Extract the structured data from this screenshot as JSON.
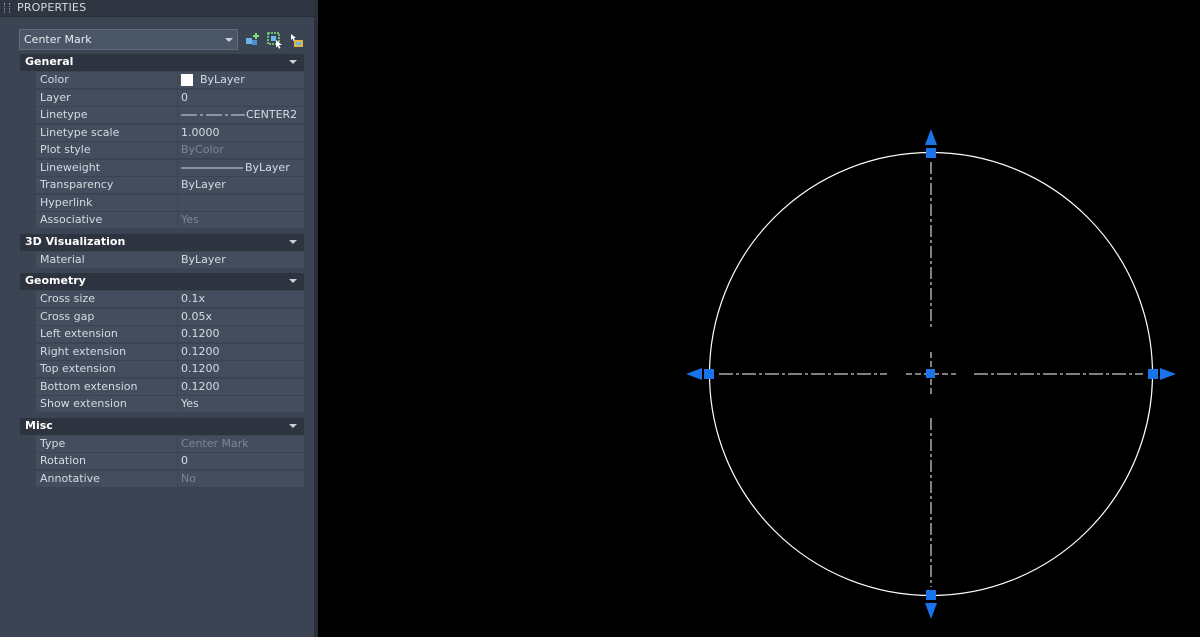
{
  "panel": {
    "title": "PROPERTIES",
    "selector": {
      "value": "Center Mark"
    },
    "toolbar": {
      "icons": [
        "toggle-pickadd-icon",
        "select-objects-icon",
        "quick-select-icon"
      ]
    }
  },
  "sections": [
    {
      "title": "General",
      "rows": [
        {
          "name": "Color",
          "value": "ByLayer",
          "swatch": "#ffffff"
        },
        {
          "name": "Layer",
          "value": "0"
        },
        {
          "name": "Linetype",
          "value": "CENTER2",
          "linetype": true
        },
        {
          "name": "Linetype scale",
          "value": "1.0000"
        },
        {
          "name": "Plot style",
          "value": "ByColor",
          "dim": true
        },
        {
          "name": "Lineweight",
          "value": "ByLayer",
          "lineweight": true
        },
        {
          "name": "Transparency",
          "value": "ByLayer"
        },
        {
          "name": "Hyperlink",
          "value": ""
        },
        {
          "name": "Associative",
          "value": "Yes",
          "dim": true
        }
      ]
    },
    {
      "title": "3D Visualization",
      "rows": [
        {
          "name": "Material",
          "value": "ByLayer"
        }
      ]
    },
    {
      "title": "Geometry",
      "rows": [
        {
          "name": "Cross size",
          "value": "0.1x"
        },
        {
          "name": "Cross gap",
          "value": "0.05x"
        },
        {
          "name": "Left extension",
          "value": "0.1200"
        },
        {
          "name": "Right extension",
          "value": "0.1200"
        },
        {
          "name": "Top extension",
          "value": "0.1200"
        },
        {
          "name": "Bottom extension",
          "value": "0.1200"
        },
        {
          "name": "Show extension",
          "value": "Yes"
        }
      ]
    },
    {
      "title": "Misc",
      "rows": [
        {
          "name": "Type",
          "value": "Center Mark",
          "dim": true
        },
        {
          "name": "Rotation",
          "value": "0"
        },
        {
          "name": "Annotative",
          "value": "No",
          "dim": true
        }
      ]
    }
  ],
  "colors": {
    "grip": "#1a73e8",
    "panel": "#3b4453",
    "header": "#2d3440",
    "geometry": "#ffffff"
  }
}
